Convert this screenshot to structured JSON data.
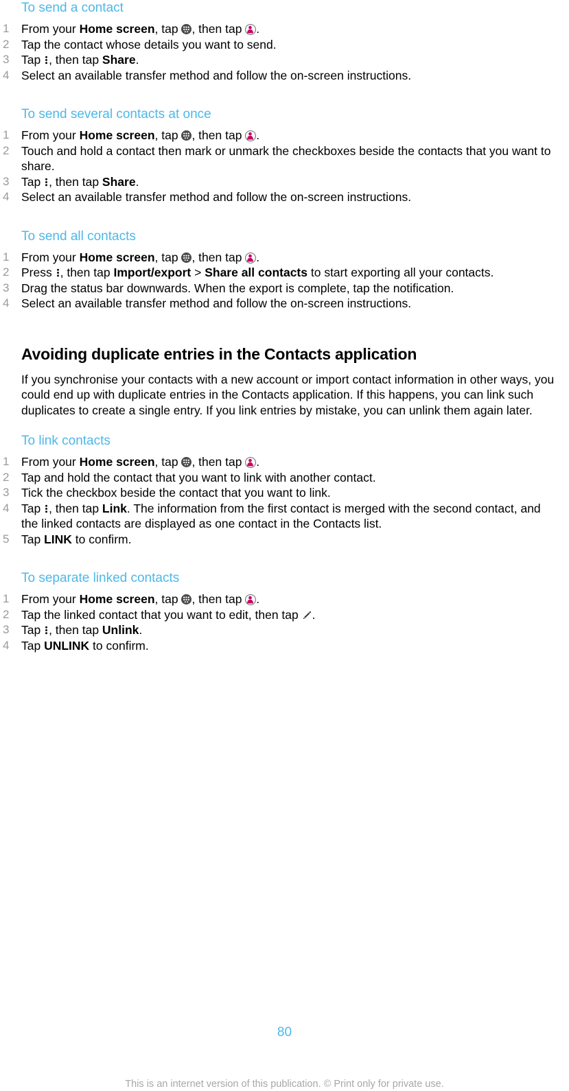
{
  "document": {
    "page_number": "80",
    "footer_note": "This is an internet version of this publication. © Print only for private use.",
    "colors": {
      "heading_blue": "#4db8e8",
      "body_black": "#000000",
      "step_number_grey": "#9a9a9a",
      "footer_grey": "#a7a7a7",
      "contacts_icon_magenta": "#cc0066",
      "appdrawer_icon_dark": "#4b4b4b"
    }
  },
  "icons": {
    "app_drawer": "app-drawer-icon",
    "contacts": "contacts-icon",
    "overflow_menu": "overflow-menu-icon",
    "pencil": "pencil-edit-icon"
  },
  "sections": [
    {
      "id": "send-a-contact",
      "heading": "To send a contact",
      "heading_level": "sub",
      "steps": [
        {
          "num": "1",
          "parts": [
            {
              "t": "text",
              "v": "From your "
            },
            {
              "t": "bold",
              "v": "Home screen"
            },
            {
              "t": "text",
              "v": ", tap "
            },
            {
              "t": "icon",
              "v": "app_drawer"
            },
            {
              "t": "text",
              "v": ", then tap "
            },
            {
              "t": "icon",
              "v": "contacts"
            },
            {
              "t": "text",
              "v": "."
            }
          ]
        },
        {
          "num": "2",
          "parts": [
            {
              "t": "text",
              "v": "Tap the contact whose details you want to send."
            }
          ]
        },
        {
          "num": "3",
          "parts": [
            {
              "t": "text",
              "v": "Tap "
            },
            {
              "t": "icon",
              "v": "overflow_menu"
            },
            {
              "t": "text",
              "v": ", then tap "
            },
            {
              "t": "bold",
              "v": "Share"
            },
            {
              "t": "text",
              "v": "."
            }
          ]
        },
        {
          "num": "4",
          "parts": [
            {
              "t": "text",
              "v": "Select an available transfer method and follow the on-screen instructions."
            }
          ]
        }
      ]
    },
    {
      "id": "send-several-contacts-at-once",
      "heading": "To send several contacts at once",
      "heading_level": "sub",
      "steps": [
        {
          "num": "1",
          "parts": [
            {
              "t": "text",
              "v": "From your "
            },
            {
              "t": "bold",
              "v": "Home screen"
            },
            {
              "t": "text",
              "v": ", tap "
            },
            {
              "t": "icon",
              "v": "app_drawer"
            },
            {
              "t": "text",
              "v": ", then tap "
            },
            {
              "t": "icon",
              "v": "contacts"
            },
            {
              "t": "text",
              "v": "."
            }
          ]
        },
        {
          "num": "2",
          "parts": [
            {
              "t": "text",
              "v": "Touch and hold a contact then mark or unmark the checkboxes beside the contacts that you want to share."
            }
          ]
        },
        {
          "num": "3",
          "parts": [
            {
              "t": "text",
              "v": "Tap "
            },
            {
              "t": "icon",
              "v": "overflow_menu"
            },
            {
              "t": "text",
              "v": ", then tap "
            },
            {
              "t": "bold",
              "v": "Share"
            },
            {
              "t": "text",
              "v": "."
            }
          ]
        },
        {
          "num": "4",
          "parts": [
            {
              "t": "text",
              "v": "Select an available transfer method and follow the on-screen instructions."
            }
          ]
        }
      ]
    },
    {
      "id": "send-all-contacts",
      "heading": "To send all contacts",
      "heading_level": "sub",
      "steps": [
        {
          "num": "1",
          "parts": [
            {
              "t": "text",
              "v": "From your "
            },
            {
              "t": "bold",
              "v": "Home screen"
            },
            {
              "t": "text",
              "v": ", tap "
            },
            {
              "t": "icon",
              "v": "app_drawer"
            },
            {
              "t": "text",
              "v": ", then tap "
            },
            {
              "t": "icon",
              "v": "contacts"
            },
            {
              "t": "text",
              "v": "."
            }
          ]
        },
        {
          "num": "2",
          "parts": [
            {
              "t": "text",
              "v": "Press "
            },
            {
              "t": "icon",
              "v": "overflow_menu"
            },
            {
              "t": "text",
              "v": ", then tap "
            },
            {
              "t": "bold",
              "v": "Import/export"
            },
            {
              "t": "text",
              "v": " > "
            },
            {
              "t": "bold",
              "v": "Share all contacts"
            },
            {
              "t": "text",
              "v": " to start exporting all your contacts."
            }
          ]
        },
        {
          "num": "3",
          "parts": [
            {
              "t": "text",
              "v": "Drag the status bar downwards. When the export is complete, tap the notification."
            }
          ]
        },
        {
          "num": "4",
          "parts": [
            {
              "t": "text",
              "v": "Select an available transfer method and follow the on-screen instructions."
            }
          ]
        }
      ]
    },
    {
      "id": "avoiding-duplicate-entries",
      "heading": "Avoiding duplicate entries in the Contacts application",
      "heading_level": "main",
      "paragraph": "If you synchronise your contacts with a new account or import contact information in other ways, you could end up with duplicate entries in the Contacts application. If this happens, you can link such duplicates to create a single entry. If you link entries by mistake, you can unlink them again later."
    },
    {
      "id": "link-contacts",
      "heading": "To link contacts",
      "heading_level": "sub",
      "steps": [
        {
          "num": "1",
          "parts": [
            {
              "t": "text",
              "v": "From your "
            },
            {
              "t": "bold",
              "v": "Home screen"
            },
            {
              "t": "text",
              "v": ", tap "
            },
            {
              "t": "icon",
              "v": "app_drawer"
            },
            {
              "t": "text",
              "v": ", then tap "
            },
            {
              "t": "icon",
              "v": "contacts"
            },
            {
              "t": "text",
              "v": "."
            }
          ]
        },
        {
          "num": "2",
          "parts": [
            {
              "t": "text",
              "v": "Tap and hold the contact that you want to link with another contact."
            }
          ]
        },
        {
          "num": "3",
          "parts": [
            {
              "t": "text",
              "v": "Tick the checkbox beside the contact that you want to link."
            }
          ]
        },
        {
          "num": "4",
          "parts": [
            {
              "t": "text",
              "v": "Tap "
            },
            {
              "t": "icon",
              "v": "overflow_menu"
            },
            {
              "t": "text",
              "v": ", then tap "
            },
            {
              "t": "bold",
              "v": "Link"
            },
            {
              "t": "text",
              "v": ". The information from the first contact is merged with the second contact, and the linked contacts are displayed as one contact in the Contacts list."
            }
          ]
        },
        {
          "num": "5",
          "parts": [
            {
              "t": "text",
              "v": "Tap "
            },
            {
              "t": "bold",
              "v": "LINK"
            },
            {
              "t": "text",
              "v": " to confirm."
            }
          ]
        }
      ]
    },
    {
      "id": "separate-linked-contacts",
      "heading": "To separate linked contacts",
      "heading_level": "sub",
      "steps": [
        {
          "num": "1",
          "parts": [
            {
              "t": "text",
              "v": "From your "
            },
            {
              "t": "bold",
              "v": "Home screen"
            },
            {
              "t": "text",
              "v": ", tap "
            },
            {
              "t": "icon",
              "v": "app_drawer"
            },
            {
              "t": "text",
              "v": ", then tap "
            },
            {
              "t": "icon",
              "v": "contacts"
            },
            {
              "t": "text",
              "v": "."
            }
          ]
        },
        {
          "num": "2",
          "parts": [
            {
              "t": "text",
              "v": "Tap the linked contact that you want to edit, then tap "
            },
            {
              "t": "icon",
              "v": "pencil"
            },
            {
              "t": "text",
              "v": "."
            }
          ]
        },
        {
          "num": "3",
          "parts": [
            {
              "t": "text",
              "v": "Tap "
            },
            {
              "t": "icon",
              "v": "overflow_menu"
            },
            {
              "t": "text",
              "v": ", then tap "
            },
            {
              "t": "bold",
              "v": "Unlink"
            },
            {
              "t": "text",
              "v": "."
            }
          ]
        },
        {
          "num": "4",
          "parts": [
            {
              "t": "text",
              "v": "Tap "
            },
            {
              "t": "bold",
              "v": "UNLINK"
            },
            {
              "t": "text",
              "v": " to confirm."
            }
          ]
        }
      ]
    }
  ]
}
